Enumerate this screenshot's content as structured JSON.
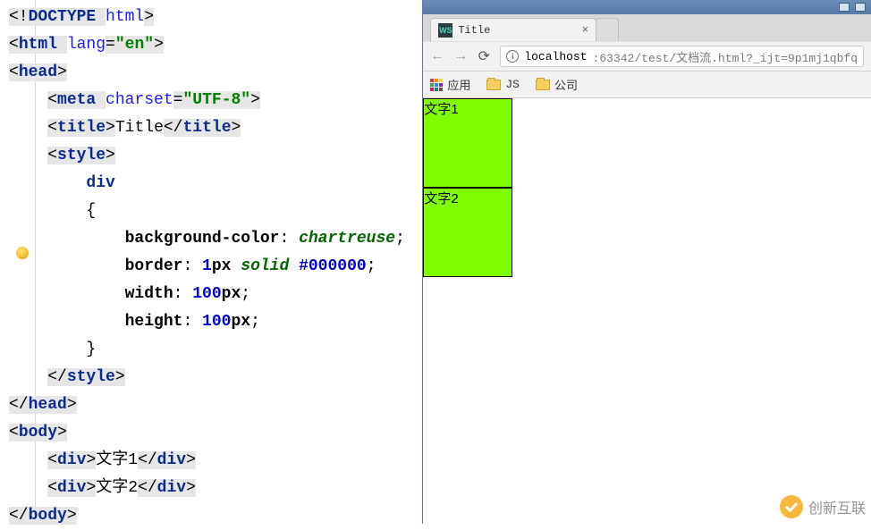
{
  "editor": {
    "code_lines": [
      {
        "indent": 0,
        "segs": [
          {
            "t": "m",
            "c": "<!"
          },
          {
            "t": "kw",
            "c": "DOCTYPE "
          },
          {
            "t": "an",
            "c": "html"
          },
          {
            "t": "m",
            "c": ">"
          }
        ]
      },
      {
        "indent": 0,
        "segs": [
          {
            "t": "m",
            "c": "<"
          },
          {
            "t": "kw",
            "c": "html "
          },
          {
            "t": "an",
            "c": "lang"
          },
          {
            "t": "eq",
            "c": "="
          },
          {
            "t": "av",
            "c": "\"en\""
          },
          {
            "t": "m",
            "c": ">"
          }
        ]
      },
      {
        "indent": 0,
        "segs": [
          {
            "t": "m",
            "c": "<"
          },
          {
            "t": "kw",
            "c": "head"
          },
          {
            "t": "m",
            "c": ">"
          }
        ]
      },
      {
        "indent": 1,
        "segs": [
          {
            "t": "m",
            "c": "<"
          },
          {
            "t": "kw",
            "c": "meta "
          },
          {
            "t": "an",
            "c": "charset"
          },
          {
            "t": "eq",
            "c": "="
          },
          {
            "t": "av",
            "c": "\"UTF-8\""
          },
          {
            "t": "m",
            "c": ">"
          }
        ]
      },
      {
        "indent": 1,
        "segs": [
          {
            "t": "m",
            "c": "<"
          },
          {
            "t": "kw",
            "c": "title"
          },
          {
            "t": "m",
            "c": ">"
          },
          {
            "t": "text",
            "c": "Title"
          },
          {
            "t": "m",
            "c": "</"
          },
          {
            "t": "kw",
            "c": "title"
          },
          {
            "t": "m",
            "c": ">"
          }
        ]
      },
      {
        "indent": 1,
        "segs": [
          {
            "t": "m",
            "c": "<"
          },
          {
            "t": "kw",
            "c": "style"
          },
          {
            "t": "m",
            "c": ">"
          }
        ]
      },
      {
        "indent": 2,
        "segs": [
          {
            "t": "sel",
            "c": "div"
          }
        ]
      },
      {
        "indent": 2,
        "segs": [
          {
            "t": "text",
            "c": "{"
          }
        ]
      },
      {
        "indent": 3,
        "segs": [
          {
            "t": "prop",
            "c": "background-color"
          },
          {
            "t": "text",
            "c": ": "
          },
          {
            "t": "val-kw",
            "c": "chartreuse"
          },
          {
            "t": "text",
            "c": ";"
          }
        ]
      },
      {
        "indent": 3,
        "hl": true,
        "segs": [
          {
            "t": "prop",
            "c": "border"
          },
          {
            "t": "text",
            "c": ": "
          },
          {
            "t": "val-num",
            "c": "1"
          },
          {
            "t": "prop",
            "c": "px "
          },
          {
            "t": "val-kw",
            "c": "solid "
          },
          {
            "t": "val-num",
            "c": "#000000"
          },
          {
            "t": "text",
            "c": ";"
          }
        ]
      },
      {
        "indent": 3,
        "segs": [
          {
            "t": "prop",
            "c": "width"
          },
          {
            "t": "text",
            "c": ": "
          },
          {
            "t": "val-num",
            "c": "100"
          },
          {
            "t": "prop",
            "c": "px"
          },
          {
            "t": "text",
            "c": ";"
          }
        ]
      },
      {
        "indent": 3,
        "segs": [
          {
            "t": "prop",
            "c": "height"
          },
          {
            "t": "text",
            "c": ": "
          },
          {
            "t": "val-num",
            "c": "100"
          },
          {
            "t": "prop",
            "c": "px"
          },
          {
            "t": "text",
            "c": ";"
          }
        ]
      },
      {
        "indent": 2,
        "segs": [
          {
            "t": "text",
            "c": "}"
          }
        ]
      },
      {
        "indent": 1,
        "segs": [
          {
            "t": "m",
            "c": "</"
          },
          {
            "t": "kw",
            "c": "style"
          },
          {
            "t": "m",
            "c": ">"
          }
        ]
      },
      {
        "indent": 0,
        "segs": [
          {
            "t": "m",
            "c": "</"
          },
          {
            "t": "kw",
            "c": "head"
          },
          {
            "t": "m",
            "c": ">"
          }
        ]
      },
      {
        "indent": 0,
        "segs": [
          {
            "t": "m",
            "c": "<"
          },
          {
            "t": "kw",
            "c": "body"
          },
          {
            "t": "m",
            "c": ">"
          }
        ]
      },
      {
        "indent": 1,
        "segs": [
          {
            "t": "m",
            "c": "<"
          },
          {
            "t": "kw",
            "c": "div"
          },
          {
            "t": "m",
            "c": ">"
          },
          {
            "t": "text",
            "c": "文字1"
          },
          {
            "t": "m",
            "c": "</"
          },
          {
            "t": "kw",
            "c": "div"
          },
          {
            "t": "m",
            "c": ">"
          }
        ]
      },
      {
        "indent": 1,
        "segs": [
          {
            "t": "m",
            "c": "<"
          },
          {
            "t": "kw",
            "c": "div"
          },
          {
            "t": "m",
            "c": ">"
          },
          {
            "t": "text",
            "c": "文字2"
          },
          {
            "t": "m",
            "c": "</"
          },
          {
            "t": "kw",
            "c": "div"
          },
          {
            "t": "m",
            "c": ">"
          }
        ]
      },
      {
        "indent": 0,
        "segs": [
          {
            "t": "m",
            "c": "</"
          },
          {
            "t": "kw",
            "c": "body"
          },
          {
            "t": "m",
            "c": ">"
          }
        ]
      }
    ]
  },
  "browser": {
    "tab_title": "Title",
    "favicon_text": "WS",
    "url_host": "localhost",
    "url_rest": ":63342/test/文档流.html?_ijt=9p1mj1qbfq",
    "bookmarks": {
      "apps_label": "应用",
      "items": [
        "JS",
        "公司"
      ]
    },
    "page_boxes": [
      "文字1",
      "文字2"
    ]
  },
  "watermark": "创新互联"
}
